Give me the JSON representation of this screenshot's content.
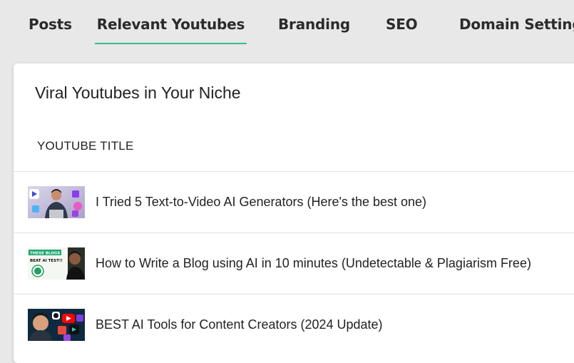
{
  "tabs": [
    {
      "label": "Posts"
    },
    {
      "label": "Relevant Youtubes"
    },
    {
      "label": "Branding"
    },
    {
      "label": "SEO"
    },
    {
      "label": "Domain Settings"
    }
  ],
  "colors": {
    "active_tab_underline": "#3dba8c",
    "page_background": "#e8e8e8",
    "card_background": "#ffffff"
  },
  "card": {
    "title": "Viral Youtubes in Your Niche",
    "column_header": "YOUTUBE TITLE"
  },
  "videos": [
    {
      "title": "I Tried 5 Text-to-Video AI Generators (Here's the best one)",
      "thumbnail": "video-thumbnail-ai-generators"
    },
    {
      "title": "How to Write a Blog using AI in 10 minutes (Undetectable & Plagiarism Free)",
      "thumbnail": "video-thumbnail-blog-writing",
      "thumbnail_text": [
        "THESE BLOGS CAN",
        "BEAT AI TEST!!"
      ]
    },
    {
      "title": "BEST AI Tools for Content Creators (2024 Update)",
      "thumbnail": "video-thumbnail-ai-tools"
    }
  ]
}
